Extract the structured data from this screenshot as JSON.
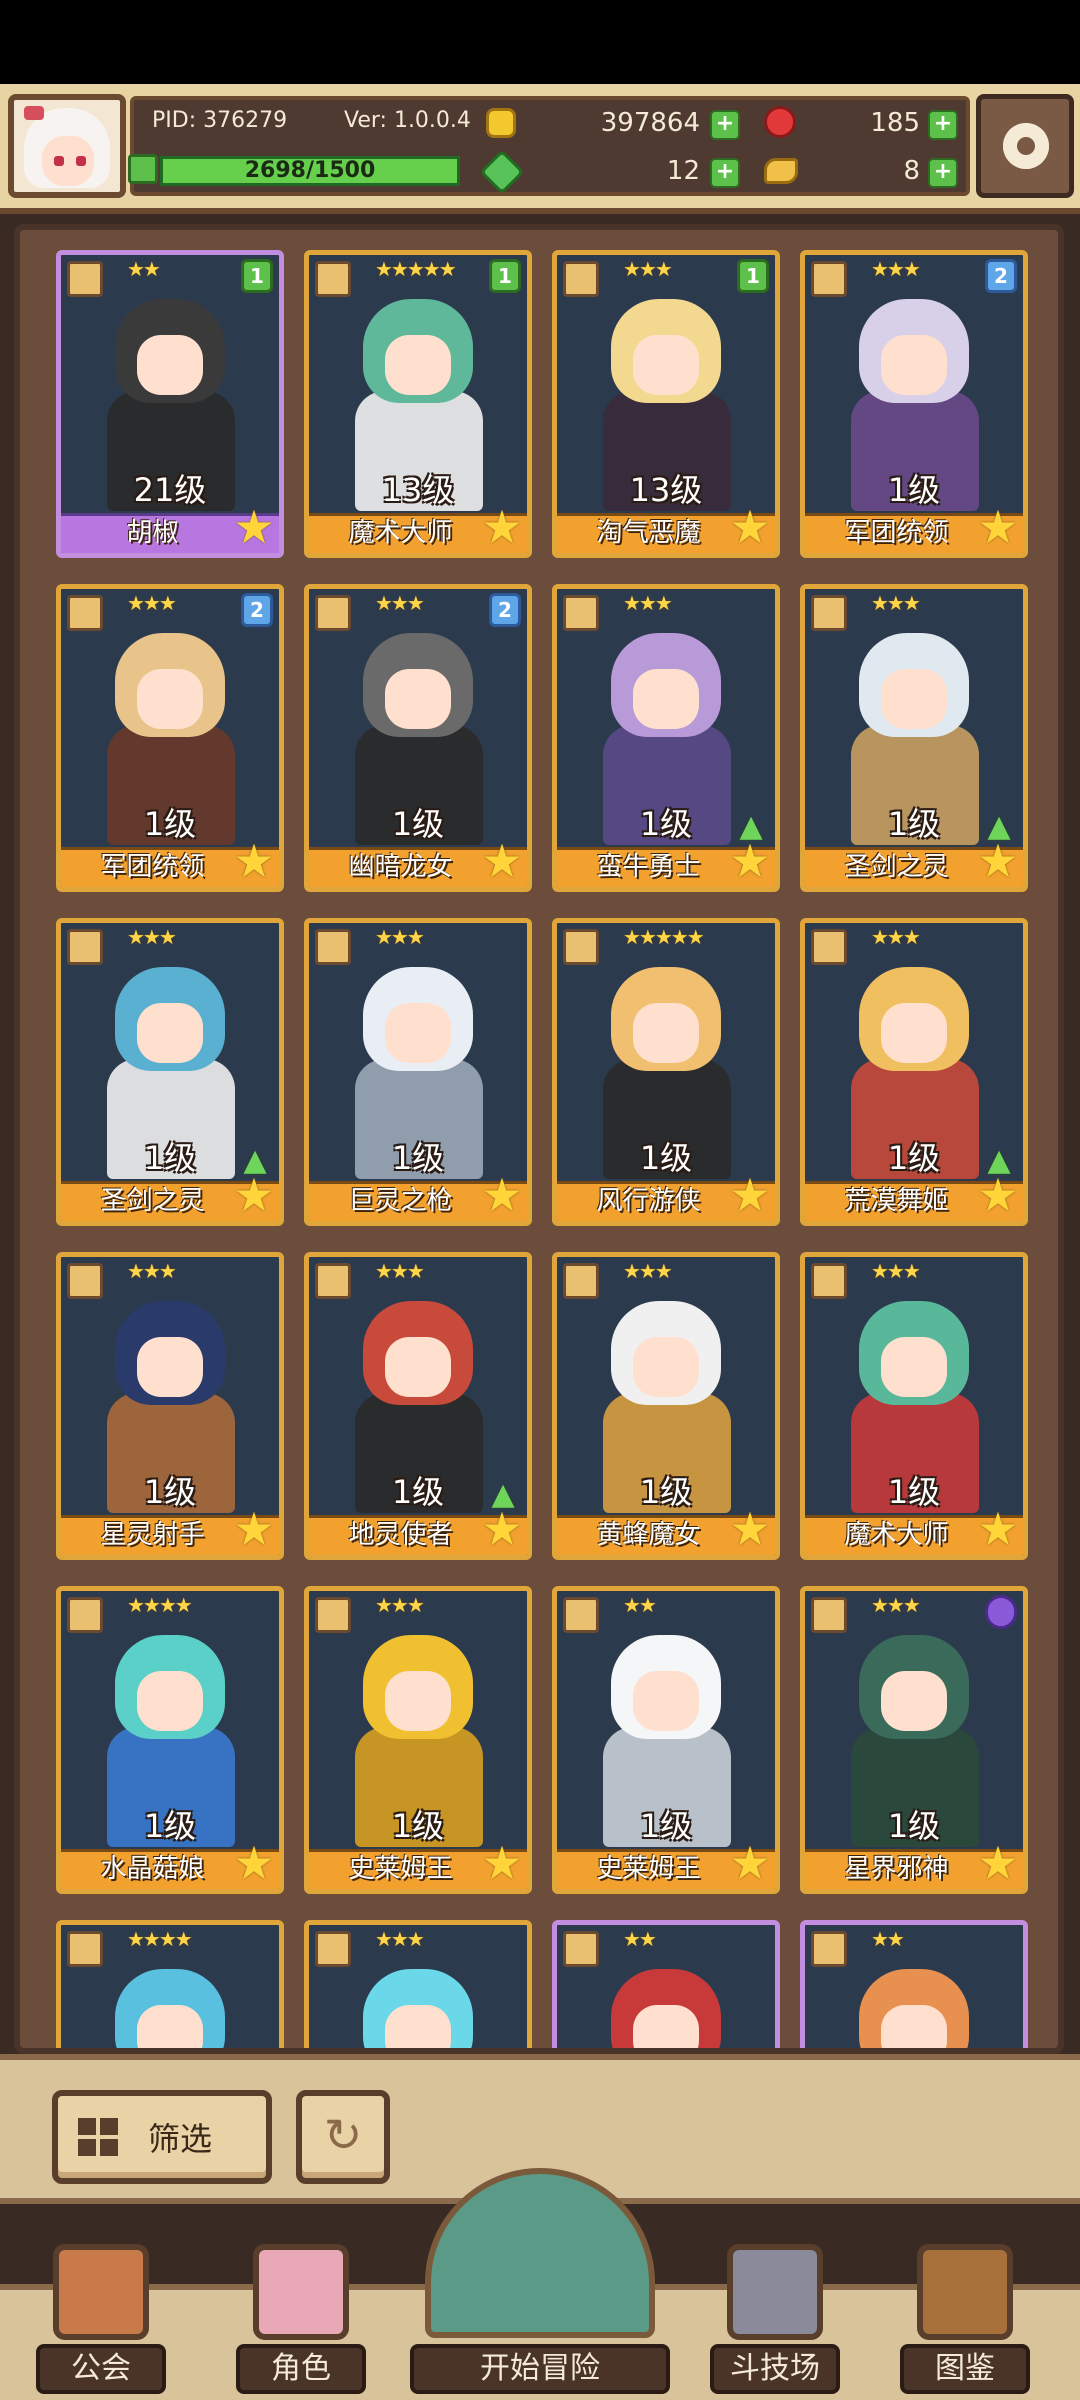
{
  "header": {
    "pid": "PID: 376279",
    "version": "Ver: 1.0.0.4",
    "gold": "397864",
    "gems": "185",
    "stamina_text": "2698/1500",
    "stamina_ratio": 1.0,
    "clover": "12",
    "horn": "8"
  },
  "cards": [
    {
      "name": "胡椒",
      "level": "21级",
      "stars": "★★",
      "badge": "1",
      "badge_type": "green",
      "frame": "purple",
      "hair": "#3a3a3a",
      "outfit": "#2a2a2a",
      "fav": true,
      "up": false
    },
    {
      "name": "魔术大师",
      "level": "13级",
      "stars": "★★★★★",
      "badge": "1",
      "badge_type": "green",
      "frame": "gold",
      "hair": "#5fb89a",
      "outfit": "#f2f2f2",
      "fav": true,
      "up": false
    },
    {
      "name": "淘气恶魔",
      "level": "13级",
      "stars": "★★★",
      "badge": "1",
      "badge_type": "green",
      "frame": "gold",
      "hair": "#f3d890",
      "outfit": "#3a2a3a",
      "fav": true,
      "up": false
    },
    {
      "name": "军团统领",
      "level": "1级",
      "stars": "★★★",
      "badge": "2",
      "badge_type": "blue",
      "frame": "gold",
      "hair": "#d8d0e8",
      "outfit": "#6a4a8a",
      "fav": true,
      "up": false
    },
    {
      "name": "军团统领",
      "level": "1级",
      "stars": "★★★",
      "badge": "2",
      "badge_type": "blue",
      "frame": "gold",
      "hair": "#e8c48a",
      "outfit": "#6a3a2a",
      "fav": true,
      "up": false
    },
    {
      "name": "幽暗龙女",
      "level": "1级",
      "stars": "★★★",
      "badge": "2",
      "badge_type": "blue",
      "frame": "gold",
      "hair": "#6a6a6a",
      "outfit": "#2a2a2a",
      "fav": true,
      "up": false
    },
    {
      "name": "蛮牛勇士",
      "level": "1级",
      "stars": "★★★",
      "badge": "",
      "badge_type": "",
      "frame": "gold",
      "hair": "#b89ad8",
      "outfit": "#5a4a8a",
      "fav": true,
      "up": true
    },
    {
      "name": "圣剑之灵",
      "level": "1级",
      "stars": "★★★",
      "badge": "",
      "badge_type": "",
      "frame": "gold",
      "hair": "#e0e8f0",
      "outfit": "#c8a060",
      "fav": true,
      "up": true
    },
    {
      "name": "圣剑之灵",
      "level": "1级",
      "stars": "★★★",
      "badge": "",
      "badge_type": "",
      "frame": "gold",
      "hair": "#5ab0d0",
      "outfit": "#f0f0f0",
      "fav": true,
      "up": true
    },
    {
      "name": "巨灵之枪",
      "level": "1级",
      "stars": "★★★",
      "badge": "",
      "badge_type": "",
      "frame": "gold",
      "hair": "#e8eef4",
      "outfit": "#9aa8b8",
      "fav": true,
      "up": false
    },
    {
      "name": "风行游侠",
      "level": "1级",
      "stars": "★★★★★",
      "badge": "",
      "badge_type": "",
      "frame": "gold",
      "hair": "#f0c070",
      "outfit": "#2a2a2a",
      "fav": true,
      "up": false
    },
    {
      "name": "荒漠舞姬",
      "level": "1级",
      "stars": "★★★",
      "badge": "",
      "badge_type": "",
      "frame": "gold",
      "hair": "#f0c060",
      "outfit": "#c84a3a",
      "fav": true,
      "up": true
    },
    {
      "name": "星灵射手",
      "level": "1级",
      "stars": "★★★",
      "badge": "",
      "badge_type": "",
      "frame": "gold",
      "hair": "#2a3a6a",
      "outfit": "#a86a3a",
      "fav": true,
      "up": false
    },
    {
      "name": "地灵使者",
      "level": "1级",
      "stars": "★★★",
      "badge": "",
      "badge_type": "",
      "frame": "gold",
      "hair": "#c84a3a",
      "outfit": "#2a2a2a",
      "fav": true,
      "up": true
    },
    {
      "name": "黄蜂魔女",
      "level": "1级",
      "stars": "★★★",
      "badge": "",
      "badge_type": "",
      "frame": "gold",
      "hair": "#f0f0f0",
      "outfit": "#d8a040",
      "fav": true,
      "up": false
    },
    {
      "name": "魔术大师",
      "level": "1级",
      "stars": "★★★",
      "badge": "",
      "badge_type": "",
      "frame": "gold",
      "hair": "#5ab89a",
      "outfit": "#c83a3a",
      "fav": true,
      "up": false
    },
    {
      "name": "水晶菇娘",
      "level": "1级",
      "stars": "★★★★",
      "badge": "",
      "badge_type": "",
      "frame": "gold",
      "hair": "#5ad0c8",
      "outfit": "#3a7ad0",
      "fav": true,
      "up": false
    },
    {
      "name": "史莱姆王",
      "level": "1级",
      "stars": "★★★",
      "badge": "",
      "badge_type": "",
      "frame": "gold",
      "hair": "#f0c030",
      "outfit": "#d8a020",
      "fav": true,
      "up": false
    },
    {
      "name": "史莱姆王",
      "level": "1级",
      "stars": "★★",
      "badge": "",
      "badge_type": "",
      "frame": "gold",
      "hair": "#f4f6f8",
      "outfit": "#c8d0d8",
      "fav": true,
      "up": false
    },
    {
      "name": "星界邪神",
      "level": "1级",
      "stars": "★★★",
      "badge": "",
      "badge_type": "violet",
      "frame": "gold",
      "hair": "#3a6a5a",
      "outfit": "#2a4a3a",
      "fav": true,
      "up": false
    },
    {
      "name": "",
      "level": "",
      "stars": "★★★★",
      "badge": "",
      "badge_type": "",
      "frame": "gold",
      "hair": "#5ac0e0",
      "outfit": "#3a8ab0",
      "fav": false,
      "up": false
    },
    {
      "name": "",
      "level": "",
      "stars": "★★★",
      "badge": "",
      "badge_type": "",
      "frame": "gold",
      "hair": "#6ad8e8",
      "outfit": "#5ab0c8",
      "fav": false,
      "up": false
    },
    {
      "name": "",
      "level": "",
      "stars": "★★",
      "badge": "",
      "badge_type": "",
      "frame": "purple",
      "hair": "#c83a3a",
      "outfit": "#3a2a2a",
      "fav": false,
      "up": false
    },
    {
      "name": "",
      "level": "",
      "stars": "★★",
      "badge": "",
      "badge_type": "",
      "frame": "purple",
      "hair": "#e89050",
      "outfit": "#6a4a3a",
      "fav": false,
      "up": false
    }
  ],
  "filter": {
    "label": "筛选"
  },
  "nav": {
    "guild": "公会",
    "character": "角色",
    "adventure": "开始冒险",
    "arena": "斗技场",
    "codex": "图鉴"
  }
}
